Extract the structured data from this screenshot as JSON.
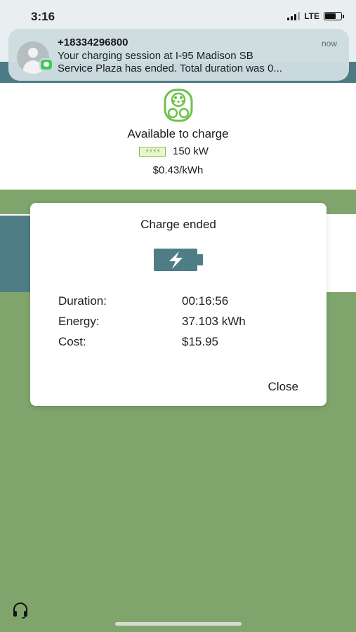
{
  "status_bar": {
    "time": "3:16",
    "network": "LTE",
    "icons": [
      "signal-icon",
      "battery-icon"
    ]
  },
  "notification": {
    "sender": "+18334296800",
    "time": "now",
    "message_line1": "Your charging session at I-95 Madison SB",
    "message_line2": "Service Plaza has ended. Total duration was 0..."
  },
  "station": {
    "status": "Available to charge",
    "power": "150 kW",
    "price": "$0.43/kWh",
    "icons": [
      "plug-connector-icon",
      "lightning-badge-icon"
    ]
  },
  "dialog": {
    "title": "Charge ended",
    "details": [
      {
        "label": "Duration:",
        "value": "00:16:56"
      },
      {
        "label": "Energy:",
        "value": "37.103 kWh"
      },
      {
        "label": "Cost:",
        "value": "$15.95"
      }
    ],
    "close_label": "Close",
    "icon": "battery-charging-icon"
  },
  "colors": {
    "background_green": "#7fa56c",
    "teal": "#4e7d86",
    "plug_green": "#6cc04a"
  },
  "footer": {
    "icon": "headset-support-icon"
  }
}
